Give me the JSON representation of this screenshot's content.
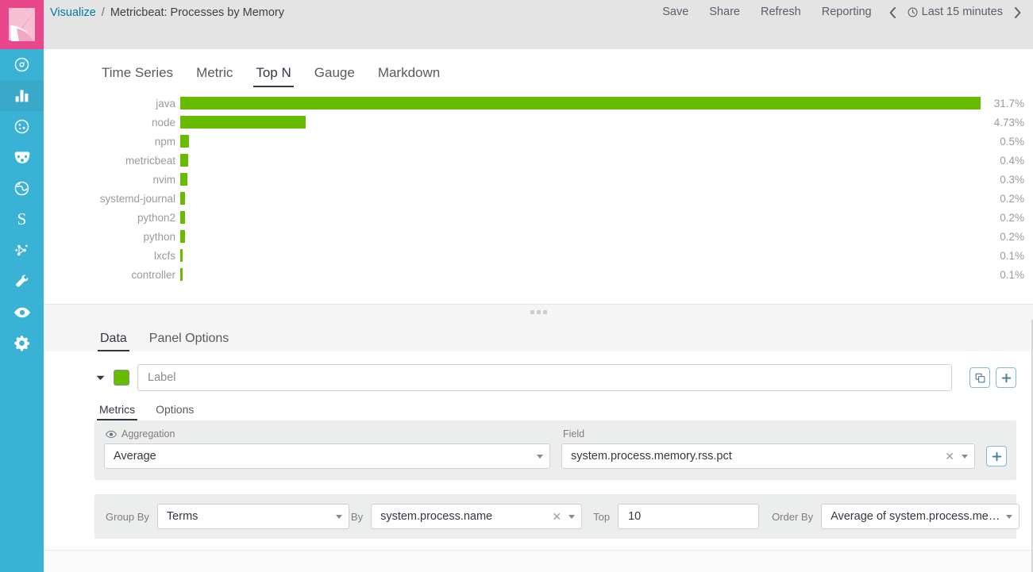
{
  "app": {
    "logo_name": "kibana-logo",
    "accent_pink": "#e8488b",
    "sidebar_blue": "#39b2d6",
    "series_green": "#68bc00"
  },
  "sidebar": {
    "items": [
      {
        "icon": "compass-icon",
        "name": "discover",
        "active": false
      },
      {
        "icon": "bar-chart-icon",
        "name": "visualize",
        "active": true
      },
      {
        "icon": "dashboard-icon",
        "name": "dashboard",
        "active": false
      },
      {
        "icon": "canvas-masks-icon",
        "name": "canvas",
        "active": false
      },
      {
        "icon": "globe-icon",
        "name": "maps",
        "active": false
      },
      {
        "icon": "letter-s-icon",
        "name": "siem",
        "label": "S",
        "active": false
      },
      {
        "icon": "graph-nodes-icon",
        "name": "graph",
        "active": false
      },
      {
        "icon": "wrench-icon",
        "name": "dev-tools",
        "active": false
      },
      {
        "icon": "eye-icon",
        "name": "monitoring",
        "active": false
      },
      {
        "icon": "gear-icon",
        "name": "management",
        "active": false
      }
    ]
  },
  "header": {
    "breadcrumb": {
      "root": "Visualize",
      "separator": "/",
      "current": "Metricbeat: Processes by Memory"
    },
    "actions": [
      {
        "label": "Save",
        "name": "save-button"
      },
      {
        "label": "Share",
        "name": "share-button"
      },
      {
        "label": "Refresh",
        "name": "refresh-button"
      },
      {
        "label": "Reporting",
        "name": "reporting-button"
      }
    ],
    "time_picker": {
      "prev_label": "‹",
      "next_label": "›",
      "clock_icon": "clock-icon",
      "range_label": "Last 15 minutes"
    }
  },
  "vis_tabs": {
    "items": [
      {
        "label": "Time Series",
        "active": false
      },
      {
        "label": "Metric",
        "active": false
      },
      {
        "label": "Top N",
        "active": true
      },
      {
        "label": "Gauge",
        "active": false
      },
      {
        "label": "Markdown",
        "active": false
      }
    ]
  },
  "chart_data": {
    "type": "bar",
    "orientation": "horizontal",
    "title": "Metricbeat: Processes by Memory",
    "xlabel": "",
    "ylabel": "",
    "unit": "%",
    "bar_color": "#68bc00",
    "xlim": [
      0,
      31.7
    ],
    "grid": false,
    "legend": "none",
    "categories": [
      "java",
      "node",
      "npm",
      "metricbeat",
      "nvim",
      "systemd-journal",
      "python2",
      "python",
      "lxcfs",
      "controller"
    ],
    "values": [
      31.7,
      4.73,
      0.5,
      0.4,
      0.3,
      0.2,
      0.2,
      0.2,
      0.1,
      0.1
    ],
    "value_labels": [
      "31.7%",
      "4.73%",
      "0.5%",
      "0.4%",
      "0.3%",
      "0.2%",
      "0.2%",
      "0.2%",
      "0.1%",
      "0.1%"
    ],
    "bar_width_pct": [
      100,
      15.0,
      1.05,
      0.95,
      0.85,
      0.6,
      0.6,
      0.6,
      0.3,
      0.3
    ]
  },
  "resizer": {
    "name": "panel-resize-handle"
  },
  "editor": {
    "tabs": [
      {
        "label": "Data",
        "active": true
      },
      {
        "label": "Panel Options",
        "active": false
      }
    ],
    "series": {
      "collapse_icon": "chevron-down-icon",
      "color_swatch": "#68bc00",
      "label_value": "",
      "label_placeholder": "Label",
      "clone_button": "clone-series-button",
      "add_button": "add-series-button"
    },
    "sub_tabs": [
      {
        "label": "Metrics",
        "active": true
      },
      {
        "label": "Options",
        "active": false
      }
    ],
    "metric": {
      "aggregation_label": "Aggregation",
      "aggregation_value": "Average",
      "visibility_icon": "eye-icon",
      "field_label": "Field",
      "field_value": "system.process.memory.rss.pct",
      "add_metric_button": "add-metric-button"
    },
    "group_by": {
      "group_by_label": "Group By",
      "group_by_value": "Terms",
      "by_label": "By",
      "by_value": "system.process.name",
      "top_label": "Top",
      "top_value": "10",
      "order_by_label": "Order By",
      "order_by_value": "Average of system.process.memory..."
    }
  }
}
